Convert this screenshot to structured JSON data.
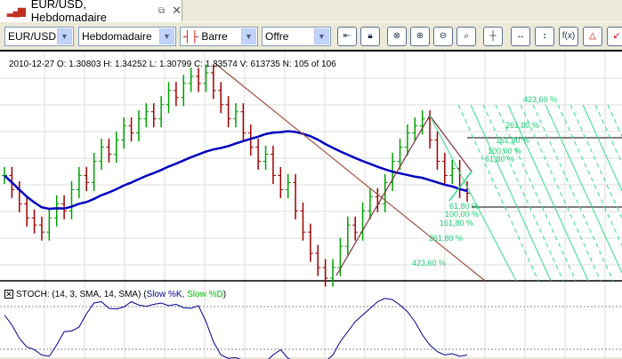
{
  "tab": {
    "title": "EUR/USD, Hebdomadaire",
    "icon": "chart-bars-icon"
  },
  "toolbar": {
    "symbol": "EUR/USD",
    "period": "Hebdomadaire",
    "chart_type": "Barre",
    "price_side": "Offre",
    "buttons": [
      "scroll-to-end",
      "lock",
      "zoom-reset",
      "zoom-in",
      "zoom-out",
      "zoom-area",
      "crosshair",
      "fit-horizontal",
      "fit-vertical",
      "indicators-fx",
      "drawing-tools",
      "fibonacci-tools"
    ],
    "fx_label": "f(x)"
  },
  "info": {
    "text": "2010-12-27   O: 1.30803   H: 1.34252   L: 1.30799   C: 1.33574   V: 613735   N: 105 of 106"
  },
  "colors": {
    "up": "#00a000",
    "down": "#a00000",
    "ma": "#0000c0",
    "fib": "#33dd88",
    "trend": "#a05040",
    "stoch_k": "#000090",
    "stoch_d": "#00c000"
  },
  "chart_data": {
    "type": "bar",
    "closes": [
      1.33,
      1.31,
      1.29,
      1.27,
      1.26,
      1.25,
      1.27,
      1.29,
      1.28,
      1.31,
      1.33,
      1.32,
      1.35,
      1.37,
      1.36,
      1.38,
      1.4,
      1.39,
      1.41,
      1.42,
      1.41,
      1.43,
      1.45,
      1.44,
      1.46,
      1.47,
      1.46,
      1.475,
      1.45,
      1.43,
      1.41,
      1.42,
      1.39,
      1.37,
      1.35,
      1.36,
      1.33,
      1.31,
      1.32,
      1.28,
      1.25,
      1.22,
      1.2,
      1.185,
      1.2,
      1.23,
      1.26,
      1.25,
      1.28,
      1.3,
      1.29,
      1.32,
      1.35,
      1.37,
      1.39,
      1.4,
      1.41,
      1.38,
      1.35,
      1.33,
      1.34,
      1.31,
      1.305
    ],
    "ylim": [
      1.18,
      1.5
    ],
    "fib_labels_upper": [
      "423,60 %",
      "261,80 %",
      "161,80 %",
      "100,00 %",
      "61,80 %"
    ],
    "fib_labels_lower": [
      "61,80 %",
      "100,00 %",
      "161,80 %",
      "261,80 %",
      "423,60 %"
    ]
  },
  "stoch": {
    "label": "STOCH: (14, 3, SMA, 14, SMA) (",
    "k_label": "Slow %K,",
    "d_label": "Slow %D",
    "close": ")",
    "values": [
      70,
      55,
      35,
      22,
      18,
      10,
      8,
      25,
      45,
      46,
      52,
      72,
      88,
      90,
      80,
      79,
      82,
      90,
      85,
      83,
      86,
      88,
      84,
      86,
      81,
      80,
      84,
      60,
      30,
      10,
      5,
      6,
      2,
      0,
      0,
      0,
      10,
      18,
      5,
      0,
      0,
      0,
      0,
      0,
      10,
      30,
      45,
      60,
      70,
      80,
      90,
      95,
      93,
      85,
      75,
      60,
      40,
      25,
      15,
      10,
      12,
      8,
      10
    ]
  }
}
